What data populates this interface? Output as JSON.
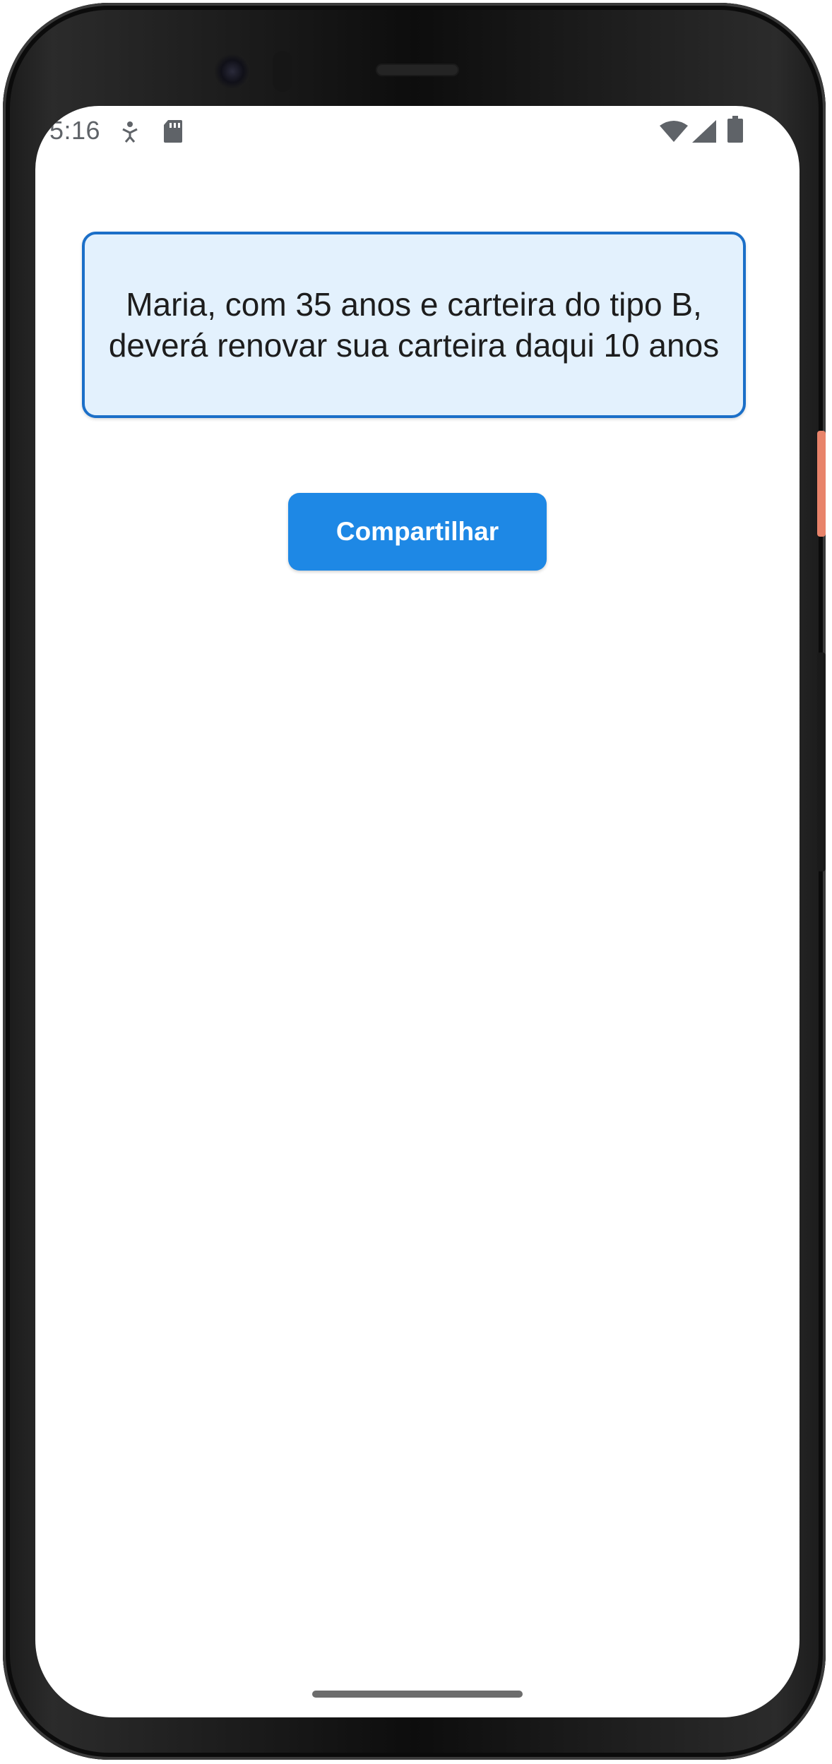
{
  "status_bar": {
    "time": "5:16",
    "left_icons": [
      "accessibility-icon",
      "sd-card-icon"
    ],
    "right_icons": [
      "wifi-icon",
      "cell-signal-icon",
      "battery-icon"
    ]
  },
  "result": {
    "message": "Maria, com 35 anos e carteira do tipo B, deverá renovar sua carteira daqui 10 anos"
  },
  "actions": {
    "share_label": "Compartilhar"
  },
  "colors": {
    "accent": "#1e88e5",
    "result_border": "#1b6fc8",
    "result_background": "#e3f1fd"
  }
}
